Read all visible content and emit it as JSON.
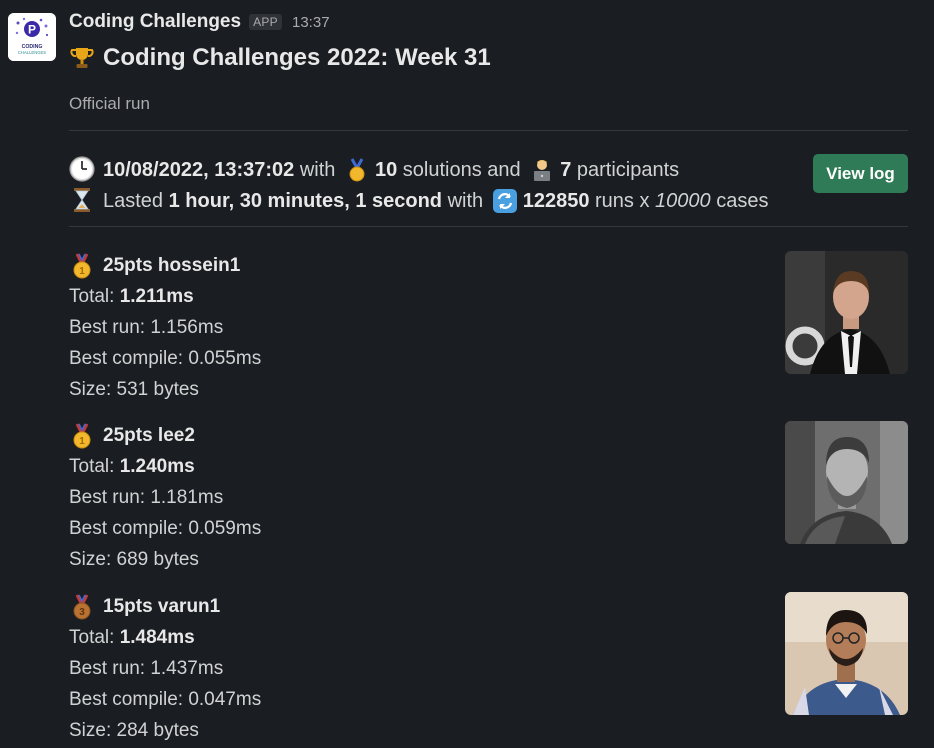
{
  "app": {
    "name": "Coding Challenges",
    "badge": "APP",
    "time": "13:37",
    "logo_text_1": "CODING",
    "logo_text_2": "CHALLENGES"
  },
  "message": {
    "title": "Coding Challenges 2022: Week 31",
    "subtitle": "Official run"
  },
  "run": {
    "datetime": "10/08/2022, 13:37:02",
    "with_text": " with ",
    "solutions_count": "10",
    "solutions_text": " solutions and ",
    "participants_count": "7",
    "participants_text": " participants",
    "lasted_prefix": "Lasted ",
    "duration": "1 hour, 30 minutes, 1 second",
    "with_text_2": " with ",
    "runs_count": "122850",
    "runs_text": " runs x ",
    "cases_count": "10000",
    "cases_text": " cases",
    "view_log_label": "View log"
  },
  "entries": [
    {
      "medal": "gold",
      "header": "25pts hossein1",
      "total_label": "Total: ",
      "total_value": "1.211ms",
      "best_run": "Best run: 1.156ms",
      "best_compile": "Best compile: 0.055ms",
      "size": "Size: 531 bytes"
    },
    {
      "medal": "gold",
      "header": "25pts lee2",
      "total_label": "Total: ",
      "total_value": "1.240ms",
      "best_run": "Best run: 1.181ms",
      "best_compile": "Best compile: 0.059ms",
      "size": "Size: 689 bytes"
    },
    {
      "medal": "bronze",
      "header": "15pts varun1",
      "total_label": "Total: ",
      "total_value": "1.484ms",
      "best_run": "Best run: 1.437ms",
      "best_compile": "Best compile: 0.047ms",
      "size": "Size: 284 bytes"
    }
  ],
  "colors": {
    "background": "#1a1d21",
    "button": "#2f7b57",
    "text": "#d1d2d3",
    "muted": "#ababad"
  }
}
